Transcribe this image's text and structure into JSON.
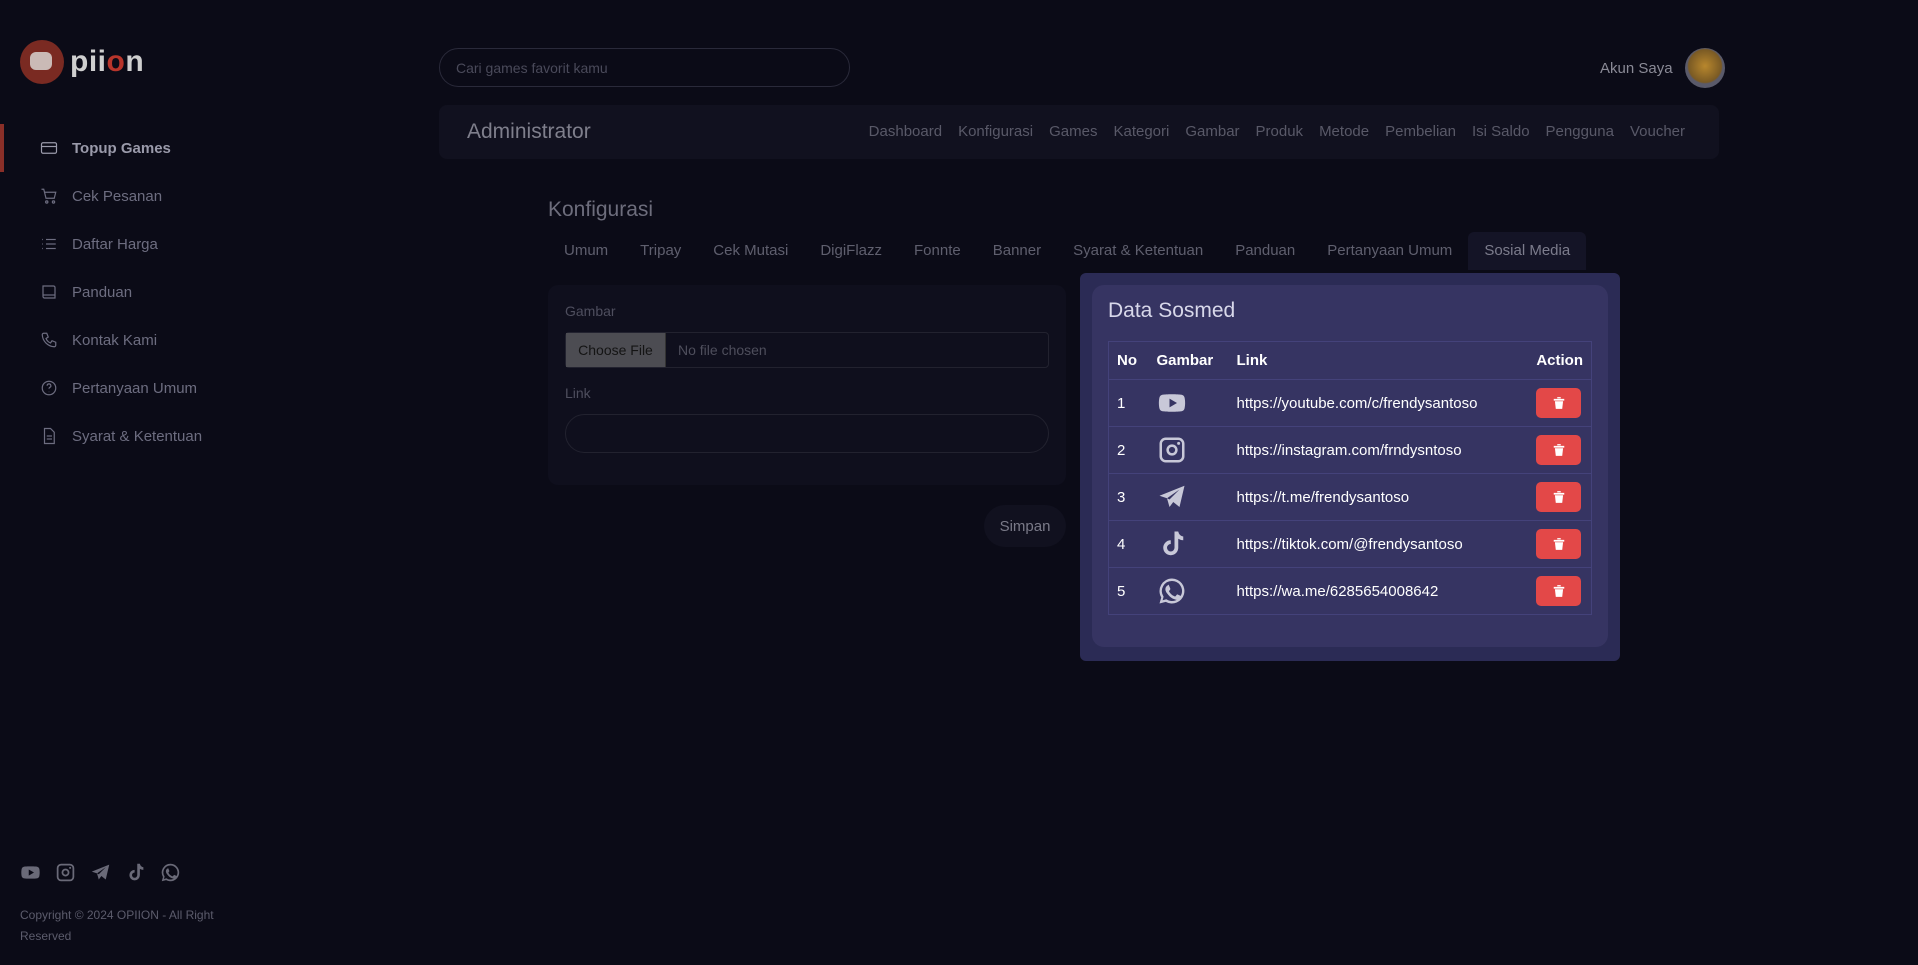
{
  "brand": {
    "name_start": "pii",
    "name_accent": "o",
    "name_end": "n"
  },
  "sidebar": {
    "items": [
      {
        "label": "Topup Games",
        "icon": "card-icon",
        "active": true
      },
      {
        "label": "Cek Pesanan",
        "icon": "cart-icon"
      },
      {
        "label": "Daftar Harga",
        "icon": "list-icon"
      },
      {
        "label": "Panduan",
        "icon": "book-icon"
      },
      {
        "label": "Kontak Kami",
        "icon": "phone-icon"
      },
      {
        "label": "Pertanyaan Umum",
        "icon": "help-icon"
      },
      {
        "label": "Syarat & Ketentuan",
        "icon": "document-icon"
      }
    ],
    "social": [
      "youtube-icon",
      "instagram-icon",
      "telegram-icon",
      "tiktok-icon",
      "whatsapp-icon"
    ],
    "copyright": "Copyright © 2024 OPIION - All Right Reserved"
  },
  "search": {
    "placeholder": "Cari games favorit kamu"
  },
  "account": {
    "label": "Akun Saya"
  },
  "admin": {
    "title": "Administrator",
    "nav": [
      "Dashboard",
      "Konfigurasi",
      "Games",
      "Kategori",
      "Gambar",
      "Produk",
      "Metode",
      "Pembelian",
      "Isi Saldo",
      "Pengguna",
      "Voucher"
    ]
  },
  "page": {
    "title": "Konfigurasi",
    "tabs": [
      "Umum",
      "Tripay",
      "Cek Mutasi",
      "DigiFlazz",
      "Fonnte",
      "Banner",
      "Syarat & Ketentuan",
      "Panduan",
      "Pertanyaan Umum",
      "Sosial Media"
    ],
    "active_tab": "Sosial Media"
  },
  "form": {
    "image_label": "Gambar",
    "file_button": "Choose File",
    "file_status": "No file chosen",
    "link_label": "Link",
    "link_value": "",
    "save_label": "Simpan"
  },
  "modal": {
    "title": "Data Sosmed",
    "columns": [
      "No",
      "Gambar",
      "Link",
      "Action"
    ],
    "rows": [
      {
        "no": "1",
        "icon": "youtube-icon",
        "link": "https://youtube.com/c/frendysantoso"
      },
      {
        "no": "2",
        "icon": "instagram-icon",
        "link": "https://instagram.com/frndysntoso"
      },
      {
        "no": "3",
        "icon": "telegram-icon",
        "link": "https://t.me/frendysantoso"
      },
      {
        "no": "4",
        "icon": "tiktok-icon",
        "link": "https://tiktok.com/@frendysantoso"
      },
      {
        "no": "5",
        "icon": "whatsapp-icon",
        "link": "https://wa.me/6285654008642"
      }
    ]
  },
  "colors": {
    "accent": "#b8352b",
    "modal_bg": "#363462",
    "delete": "#e34848"
  }
}
